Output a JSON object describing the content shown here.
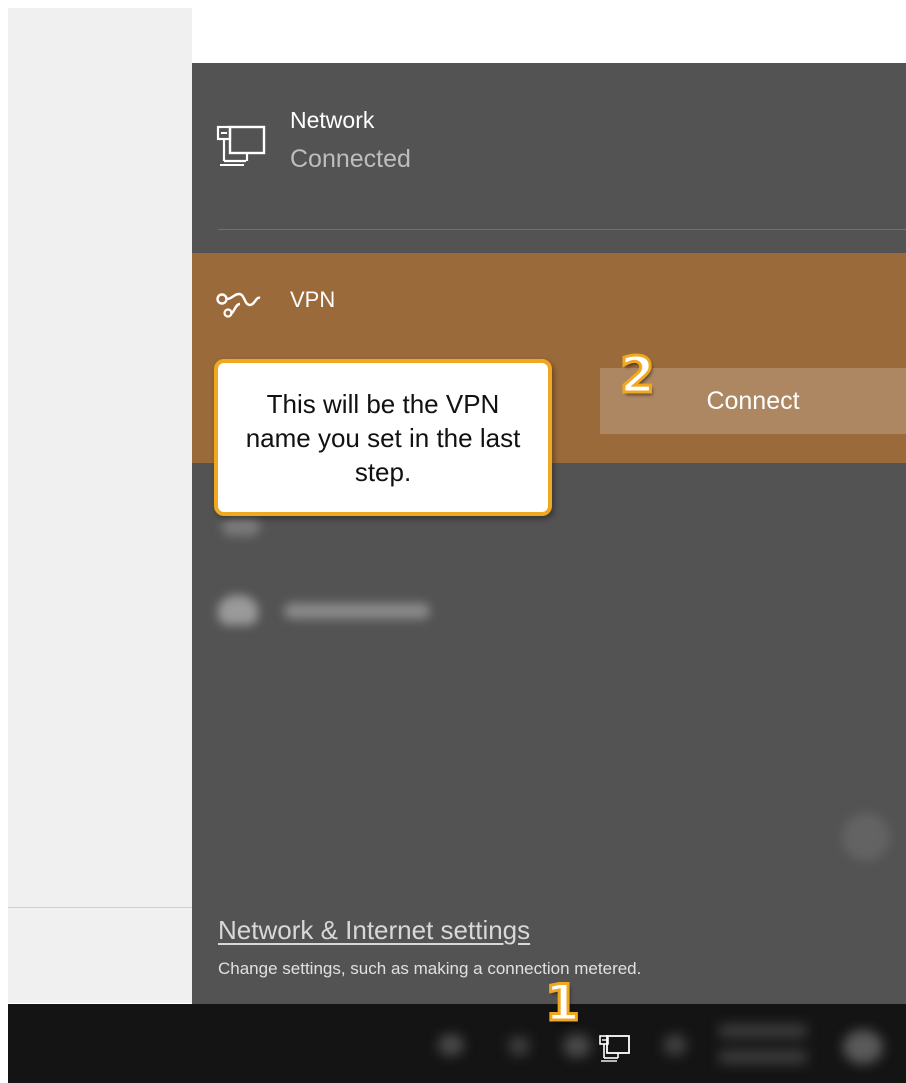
{
  "flyout": {
    "network": {
      "icon": "wired-network-icon",
      "title": "Network",
      "status": "Connected"
    },
    "vpn": {
      "icon": "vpn-icon",
      "label": "VPN",
      "connect_label": "Connect"
    },
    "footer": {
      "settings_link": "Network & Internet settings",
      "settings_description": "Change settings, such as making a connection metered."
    }
  },
  "callout": {
    "text": "This will be the VPN name you set in the last step."
  },
  "annotations": {
    "step1": "1",
    "step2": "2"
  },
  "taskbar": {
    "network_icon": "wired-network-icon"
  },
  "colors": {
    "flyout_bg": "#535353",
    "vpn_accent": "#9a6a3a",
    "connect_button": "#ad8762",
    "callout_border": "#f0a821",
    "taskbar_bg": "#141414"
  }
}
